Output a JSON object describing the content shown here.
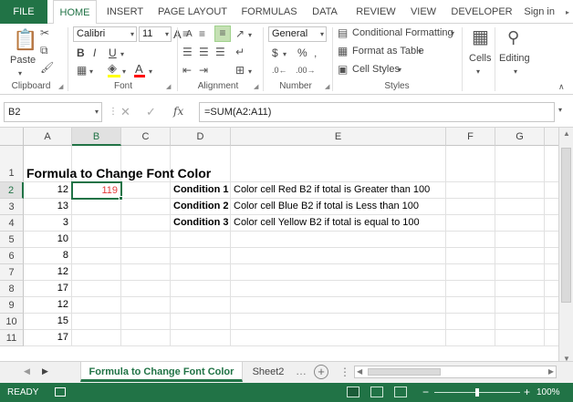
{
  "ribbon_tabs": [
    "FILE",
    "HOME",
    "INSERT",
    "PAGE LAYOUT",
    "FORMULAS",
    "DATA",
    "REVIEW",
    "VIEW",
    "DEVELOPER"
  ],
  "sign_in": "Sign in",
  "clipboard": {
    "paste": "Paste",
    "label": "Clipboard"
  },
  "font": {
    "name": "Calibri",
    "size": "11",
    "bold": "B",
    "italic": "I",
    "underline": "U",
    "grow": "A",
    "shrink": "A",
    "fill_color": "#ffff00",
    "font_color": "#ff0000",
    "label": "Font"
  },
  "alignment": {
    "label": "Alignment"
  },
  "number": {
    "format": "General",
    "currency": "$",
    "percent": "%",
    "label": "Number"
  },
  "styles": {
    "conditional": "Conditional Formatting",
    "table": "Format as Table",
    "cell_styles": "Cell Styles",
    "label": "Styles"
  },
  "cells": {
    "label": "Cells"
  },
  "editing": {
    "label": "Editing"
  },
  "formula_bar": {
    "name_box": "B2",
    "fx": "fx",
    "formula": "=SUM(A2:A11)"
  },
  "columns": [
    "A",
    "B",
    "C",
    "D",
    "E",
    "F",
    "G"
  ],
  "rows": [
    "1",
    "2",
    "3",
    "4",
    "5",
    "6",
    "7",
    "8",
    "9",
    "10",
    "11"
  ],
  "sheet": {
    "title": "Formula to Change Font Color",
    "values_a": [
      "12",
      "13",
      "3",
      "10",
      "8",
      "12",
      "17",
      "12",
      "15",
      "17"
    ],
    "b2": "119",
    "b2_color": "#e33b3b",
    "conditions": [
      {
        "label": "Condition 1",
        "text": "Color cell Red B2 if total is Greater than 100"
      },
      {
        "label": "Condition 2",
        "text": "Color cell Blue B2 if total is Less than 100"
      },
      {
        "label": "Condition 3",
        "text": "Color cell Yellow B2 if total is equal to 100"
      }
    ]
  },
  "sheet_tabs": [
    {
      "label": "Formula to Change Font Color",
      "active": true
    },
    {
      "label": "Sheet2",
      "active": false
    }
  ],
  "status": {
    "ready": "READY",
    "zoom": "100%"
  },
  "colors": {
    "accent": "#217346",
    "selected_header": "#e1e1e1"
  }
}
